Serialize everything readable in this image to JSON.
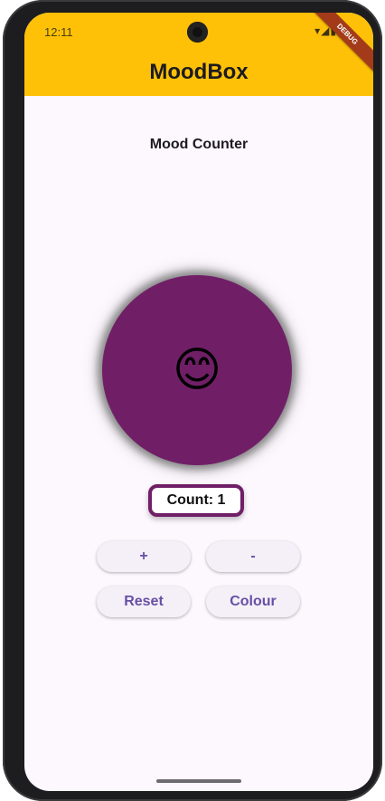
{
  "status_bar": {
    "time": "12:11",
    "icons_text": "▾◢▮",
    "debug_label": "DEBUG"
  },
  "app_bar": {
    "title": "MoodBox"
  },
  "main": {
    "subtitle": "Mood Counter",
    "mood_emoji": "😊",
    "count_text": "Count: 1",
    "buttons": {
      "plus": "+",
      "minus": "-",
      "reset": "Reset",
      "colour": "Colour"
    }
  },
  "colors": {
    "app_bar": "#ffc107",
    "mood_circle": "#701f67",
    "button_text": "#6750a4",
    "background": "#fdf7fe"
  }
}
